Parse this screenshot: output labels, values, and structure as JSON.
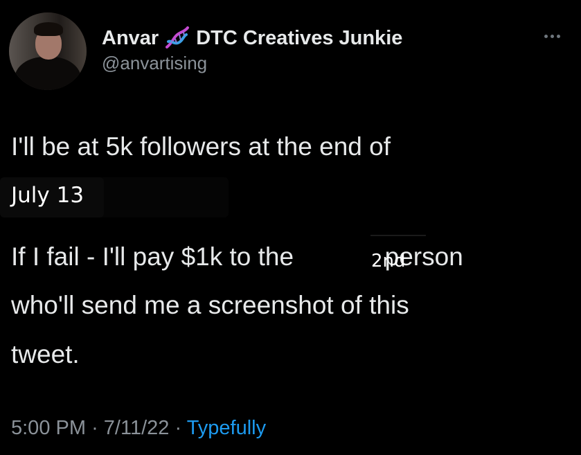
{
  "author": {
    "name": "Anvar",
    "title": "DTC Creatives Junkie",
    "handle": "@anvartising",
    "badge_icon": "dna-icon"
  },
  "tweet": {
    "line1": "I'll be at 5k followers at the end of",
    "date": "July 13",
    "line3_before": "If I fail - I'll pay $1k to the",
    "ordinal": "2nd",
    "line3_after": "person",
    "line4": "who'll send me a screenshot of this",
    "line5": "tweet."
  },
  "meta": {
    "time": "5:00 PM",
    "separator": "·",
    "date": "7/11/22",
    "source": "Typefully"
  },
  "colors": {
    "background": "#000000",
    "text": "#e7e9ea",
    "secondary": "#8b9299",
    "link": "#1d9bf0"
  },
  "more_icon": "more-horizontal-icon"
}
